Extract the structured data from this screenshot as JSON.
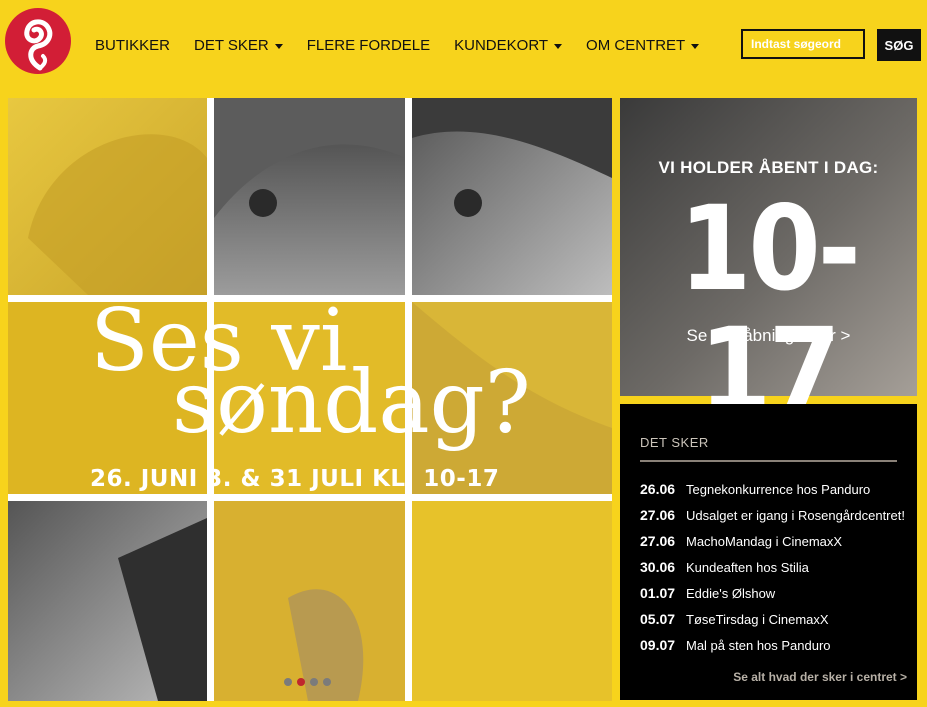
{
  "header": {
    "logo": "rosengard-swirl-logo",
    "nav": [
      {
        "label": "BUTIKKER",
        "dropdown": false
      },
      {
        "label": "DET SKER",
        "dropdown": true
      },
      {
        "label": "FLERE FORDELE",
        "dropdown": false
      },
      {
        "label": "KUNDEKORT",
        "dropdown": true
      },
      {
        "label": "OM CENTRET",
        "dropdown": true
      }
    ],
    "search": {
      "placeholder": "Indtast søgeord",
      "value": "",
      "button_label": "SØG"
    }
  },
  "hero": {
    "line1": "Ses vi",
    "line2": "søndag?",
    "dates": "26. JUNI 3. & 31 JULI KL. 10-17",
    "slides": {
      "count": 4,
      "active": 2
    }
  },
  "hours": {
    "heading": "VI HOLDER ÅBENT I DAG:",
    "time": "10-17",
    "link": "Se alle åbningstider >"
  },
  "events": {
    "heading": "DET SKER",
    "items": [
      {
        "date": "26.06",
        "title": "Tegnekonkurrence hos Panduro"
      },
      {
        "date": "27.06",
        "title": "Udsalget er igang i Rosengårdcentret!"
      },
      {
        "date": "27.06",
        "title": "MachoMandag i CinemaxX"
      },
      {
        "date": "30.06",
        "title": "Kundeaften hos Stilia"
      },
      {
        "date": "01.07",
        "title": "Eddie's Ølshow"
      },
      {
        "date": "05.07",
        "title": "TøseTirsdag i CinemaxX"
      },
      {
        "date": "09.07",
        "title": "Mal på sten hos Panduro"
      }
    ],
    "more": "Se alt hvad der sker i centret >"
  },
  "colors": {
    "accent": "#f7d31c",
    "logo": "#d21e36",
    "dark": "#000000"
  }
}
